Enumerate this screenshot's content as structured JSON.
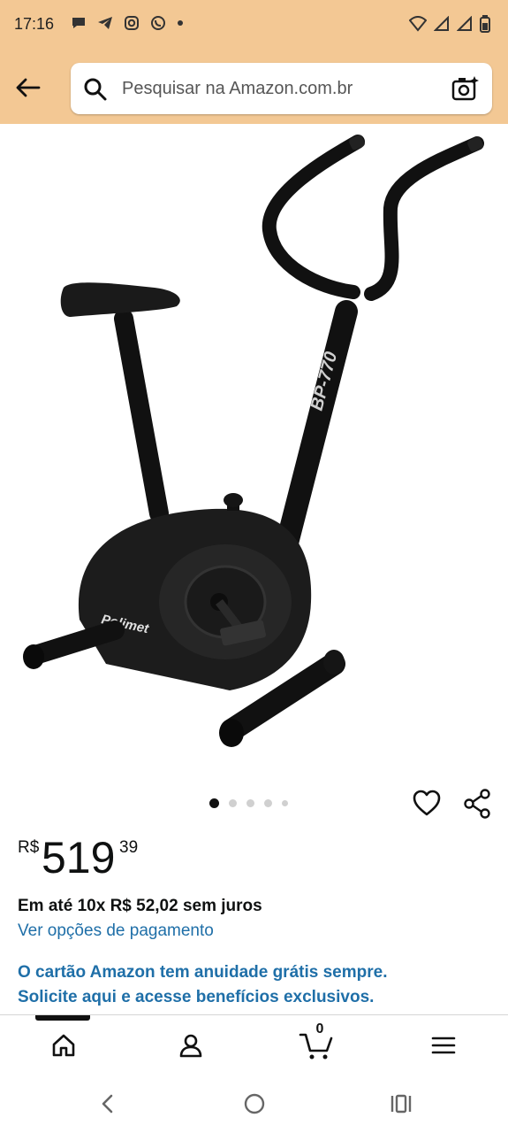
{
  "status_bar": {
    "time": "17:16",
    "left_icons": [
      "chat-bubble-icon",
      "telegram-icon",
      "instagram-icon",
      "whatsapp-icon",
      "dot-icon"
    ],
    "right_icons": [
      "wifi-icon",
      "signal-icon",
      "signal-icon",
      "battery-icon"
    ]
  },
  "search": {
    "placeholder": "Pesquisar na Amazon.com.br"
  },
  "product": {
    "image_text": {
      "model": "BP-770",
      "brand": "Polimet"
    },
    "image_count": 5,
    "active_image": 1,
    "price": {
      "currency": "R$",
      "whole": "519",
      "cents": "39"
    },
    "installments": "Em até 10x R$ 52,02 sem juros",
    "payment_options_link": "Ver opções de pagamento",
    "promo_line1": "O cartão Amazon tem anuidade grátis sempre.",
    "promo_line2": "Solicite aqui e acesse benefícios exclusivos."
  },
  "bottom_nav": {
    "items": [
      "home-icon",
      "account-icon",
      "cart-icon",
      "menu-icon"
    ],
    "cart_count": "0",
    "active": "home-icon"
  },
  "colors": {
    "header_bg": "#f3c894",
    "link_blue": "#1f6fa8",
    "text_dark": "#0f1111"
  }
}
